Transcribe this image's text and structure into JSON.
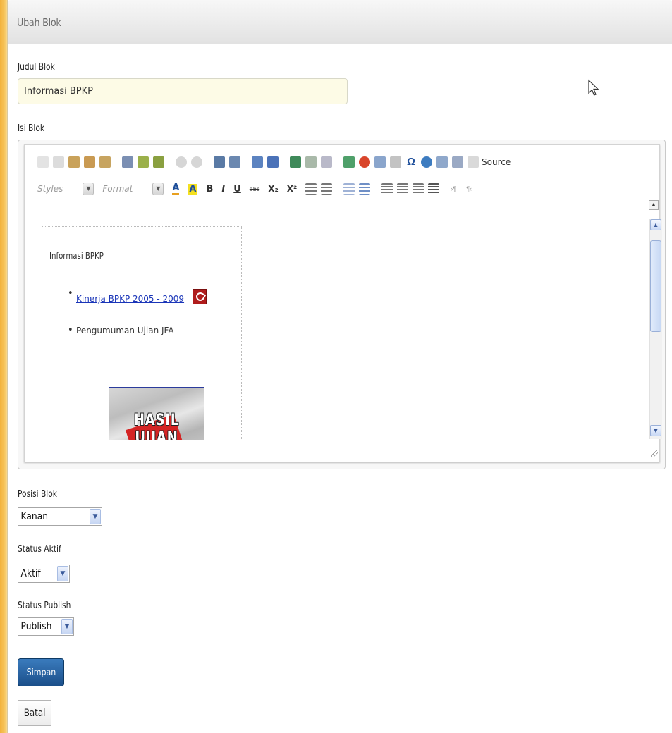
{
  "panel": {
    "title": "Ubah Blok"
  },
  "form": {
    "title_label": "Judul Blok",
    "title_value": "Informasi BPKP",
    "content_label": "Isi Blok",
    "position_label": "Posisi Blok",
    "position_value": "Kanan",
    "active_label": "Status Aktif",
    "active_value": "Aktif",
    "publish_label": "Status Publish",
    "publish_value": "Publish",
    "save_label": "Simpan",
    "cancel_label": "Batal"
  },
  "editor": {
    "source_label": "Source",
    "styles_placeholder": "Styles",
    "format_placeholder": "Format",
    "bold": "B",
    "italic": "I",
    "underline": "U",
    "strike": "abc",
    "subscript": "X₂",
    "superscript": "X²",
    "content": {
      "heading": "Informasi BPKP",
      "items": [
        {
          "text": "Kinerja BPKP 2005 - 2009",
          "link": true
        },
        {
          "text": "Pengumuman Ujian JFA",
          "link": false
        }
      ],
      "banner_text": "HASIL UJIAN"
    }
  },
  "colors": {
    "accent": "#1b4f8a",
    "background_edge": "#f3b23c",
    "input_bg": "#fdfbe6",
    "link": "#1a35b8"
  }
}
